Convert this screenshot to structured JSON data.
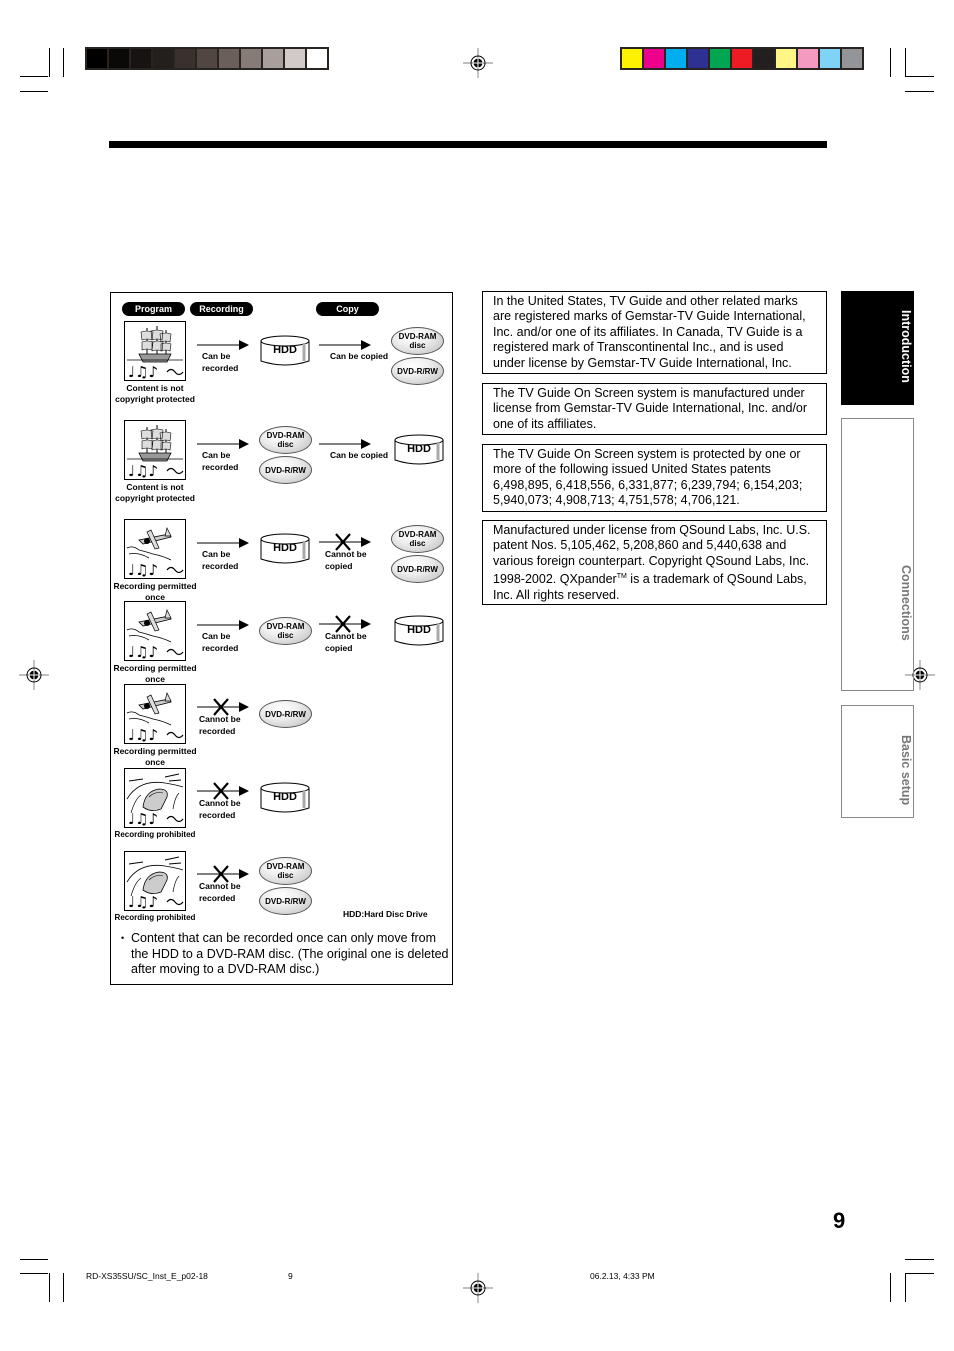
{
  "colors": {
    "gray_swatches": [
      "#000000",
      "#0b0908",
      "#171312",
      "#231f1c",
      "#3a302d",
      "#524642",
      "#6b5f5c",
      "#877b78",
      "#a89e9c",
      "#d2cac9",
      "#ffffff"
    ],
    "color_swatches": [
      "#fff200",
      "#ec008c",
      "#00aeef",
      "#2e3192",
      "#00a651",
      "#ed1c24",
      "#231f20",
      "#fff685",
      "#f49ac1",
      "#7ed3f7",
      "#939598"
    ]
  },
  "diagram": {
    "headers": {
      "program": "Program",
      "recording": "Recording",
      "copy": "Copy"
    },
    "rows": [
      {
        "picture": "ship-picture",
        "caption": "Content is not copyright protected",
        "record_label": "Can be recorded",
        "record_allowed": true,
        "record_target": [
          "HDD"
        ],
        "copy_label": "Can be copied",
        "copy_allowed": true,
        "copy_target": [
          "DVD-RAM disc",
          "DVD-R/RW"
        ]
      },
      {
        "picture": "ship-picture",
        "caption": "Content is not copyright protected",
        "record_label": "Can be recorded",
        "record_allowed": true,
        "record_target": [
          "DVD-RAM disc",
          "DVD-R/RW"
        ],
        "copy_label": "Can be copied",
        "copy_allowed": true,
        "copy_target": [
          "HDD"
        ]
      },
      {
        "picture": "airplane-picture",
        "caption": "Recording permitted once",
        "record_label": "Can be recorded",
        "record_allowed": true,
        "record_target": [
          "HDD"
        ],
        "copy_label": "Cannot be copied",
        "copy_allowed": false,
        "copy_target": [
          "DVD-RAM disc",
          "DVD-R/RW"
        ]
      },
      {
        "picture": "airplane-picture",
        "caption": "Recording permitted once",
        "record_label": "Can be recorded",
        "record_allowed": true,
        "record_target": [
          "DVD-RAM disc"
        ],
        "copy_label": "Cannot be copied",
        "copy_allowed": false,
        "copy_target": [
          "HDD"
        ]
      },
      {
        "picture": "airplane-picture",
        "caption": "Recording permitted once",
        "record_label": "Cannot be recorded",
        "record_allowed": false,
        "record_target": [
          "DVD-R/RW"
        ]
      },
      {
        "picture": "car-picture",
        "caption": "Recording prohibited",
        "record_label": "Cannot be recorded",
        "record_allowed": false,
        "record_target": [
          "HDD"
        ]
      },
      {
        "picture": "car-picture",
        "caption": "Recording prohibited",
        "record_label": "Cannot be recorded",
        "record_allowed": false,
        "record_target": [
          "DVD-RAM disc",
          "DVD-R/RW"
        ]
      }
    ],
    "legend": "HDD:Hard Disc Drive",
    "note": "Content that can be recorded once can only move from the HDD to a DVD-RAM disc. (The original one is deleted after moving to a DVD-RAM disc.)",
    "bullet": "•"
  },
  "info_boxes": [
    "In the United States, TV Guide and other related marks are registered marks of Gemstar-TV Guide International, Inc. and/or one of its affiliates. In Canada, TV Guide is a registered mark of Transcontinental Inc., and is used under license by Gemstar-TV Guide International, Inc.",
    "The TV Guide On Screen system is manufactured under license from Gemstar-TV Guide International, Inc. and/or one of its affiliates.",
    "The TV Guide On Screen system is protected by one or more of the following issued United States patents 6,498,895, 6,418,556, 6,331,877; 6,239,794; 6,154,203; 5,940,073; 4,908,713; 4,751,578; 4,706,121."
  ],
  "qsound_box": {
    "before_tm": "Manufactured under license from QSound Labs, Inc. U.S. patent Nos. 5,105,462, 5,208,860 and 5,440,638 and various foreign counterpart. Copyright QSound Labs, Inc. 1998-2002. QXpander",
    "tm": "TM",
    "after_tm": " is a trademark of QSound Labs, Inc. All rights reserved."
  },
  "side_tabs": [
    {
      "label": "Introduction",
      "active": true
    },
    {
      "label": "Connections",
      "active": false
    },
    {
      "label": "Basic setup",
      "active": false
    }
  ],
  "page_number": "9",
  "footer": {
    "file": "RD-XS35SU/SC_Inst_E_p02-18",
    "page": "9",
    "timestamp": "06.2.13, 4:33 PM"
  }
}
